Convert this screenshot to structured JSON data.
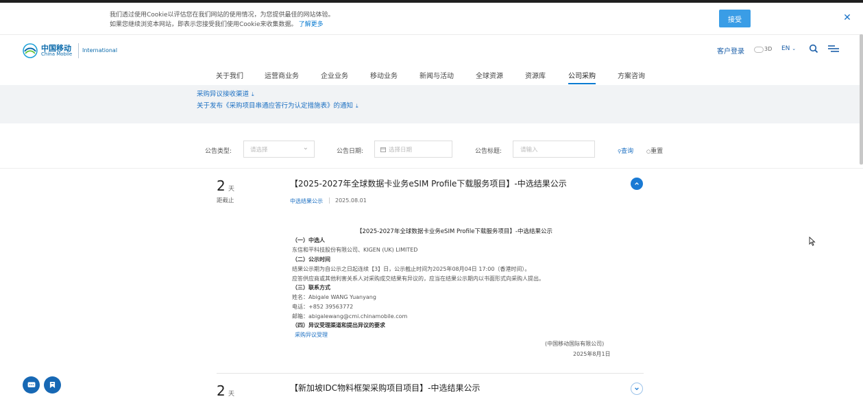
{
  "cookie": {
    "line1": "我们透过使用Cookie以评估您在我们网站的使用情况，为您提供最佳的网站体验。",
    "line2": "如果您继续浏览本网站，即表示您接受我们使用Cookie来收集数据。",
    "more_link": "了解更多",
    "accept_label": "接受",
    "close_icon": "close-icon"
  },
  "header": {
    "logo_cn": "中国移动",
    "logo_en": "China Mobile",
    "logo_intl": "International",
    "login": "客户登录",
    "mode_3d": "3D",
    "lang": "EN",
    "nav": [
      "关于我们",
      "运营商业务",
      "企业业务",
      "移动业务",
      "新闻与活动",
      "全球资源",
      "资源库",
      "公司采购",
      "方案咨询"
    ],
    "active_nav": "公司采购",
    "brand_color": "#0a7bd1"
  },
  "notice": {
    "links": [
      "采购异议接收渠道",
      "关于发布《采购项目串通应答行为认定措施表》的通知"
    ]
  },
  "filter": {
    "type_label": "公告类型:",
    "type_placeholder": "请选择",
    "date_label": "公告日期:",
    "date_placeholder": "选择日期",
    "title_label": "公告标题:",
    "title_placeholder": "请输入",
    "search_label": "查询",
    "reset_label": "重置"
  },
  "list": [
    {
      "days": "2",
      "days_unit": "天",
      "days_label": "距截止",
      "title": "【2025-2027年全球数据卡业务eSIM Profile下载服务项目】-中选结果公示",
      "type": "中选结果公示",
      "date": "2025.08.01",
      "expanded": true,
      "detail": {
        "title": "【2025-2027年全球数据卡业务eSIM Profile下载服务项目】-中选结果公示",
        "s1_head": "（一）中选人",
        "s1_body": "东信和平科技股份有限公司、KIGEN (UK) LIMITED",
        "s2_head": "（二）公示时间",
        "s2_body1": "结果公示期为自公示之日起连续【3】日，公示截止时间为2025年08月04日 17:00（香港时间）。",
        "s2_body2": "应答供应商或其他利害关系人对采购成交结果有异议的，应当在结果公示期内以书面形式向采购人提出。",
        "s3_head": "（三）联系方式",
        "name": "姓名：Abigale WANG Yuanyang",
        "phone": "电话：+852 39563772",
        "email": "邮箱：abigalewang@cmi.chinamobile.com",
        "s4_head": "（四）异议受理渠道和提出异议的要求",
        "s4_link": "采购异议受理",
        "org": "(中国移动国际有限公司)",
        "sign_date": "2025年8月1日"
      }
    },
    {
      "days": "2",
      "days_unit": "天",
      "title": "【新加坡IDC物料框架采购项目项目】-中选结果公示",
      "expanded": false
    }
  ],
  "fabs": [
    "chat-icon",
    "bookmark-icon"
  ]
}
